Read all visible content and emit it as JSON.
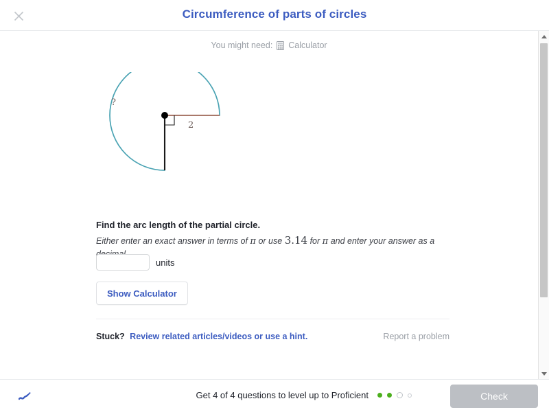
{
  "header": {
    "title": "Circumference of parts of circles",
    "close_icon": "close-icon"
  },
  "content": {
    "need_label": "You might need:",
    "calculator_label": "Calculator",
    "calculator_icon": "calculator-icon"
  },
  "figure": {
    "arc_label": "?",
    "radius_label": "2",
    "arc_color": "#4aa3b3",
    "radius_color": "#a9786a",
    "vertical_radius_color": "#1a1a1a",
    "center_dot_color": "#000000",
    "label_color": "#6b5b57",
    "arc_degrees": 270,
    "radius_value": 2
  },
  "prompt": {
    "main": "Find the arc length of the partial circle.",
    "sub_part1": "Either enter an exact answer in terms of",
    "sub_pi1": "π",
    "sub_part2": "or use",
    "sub_number": "3.14",
    "sub_part3": "for",
    "sub_pi2": "π",
    "sub_part4": "and enter your answer as a decimal."
  },
  "answer": {
    "value": "",
    "placeholder": "",
    "units_label": "units"
  },
  "buttons": {
    "show_calculator": "Show Calculator",
    "check": "Check"
  },
  "stuck": {
    "prefix": "Stuck?",
    "link": "Review related articles/videos or use a hint.",
    "report": "Report a problem"
  },
  "bottom": {
    "levelup_text": "Get 4 of 4 questions to level up to Proficient",
    "scratchpad_icon": "scratchpad-pencil-icon",
    "progress_dots": [
      "filled",
      "filled",
      "open-lg",
      "open-sm"
    ],
    "progress_filled_color": "#4caf1e"
  },
  "scrollbar": {
    "up_icon": "scroll-up-arrow-icon",
    "down_icon": "scroll-down-arrow-icon"
  }
}
